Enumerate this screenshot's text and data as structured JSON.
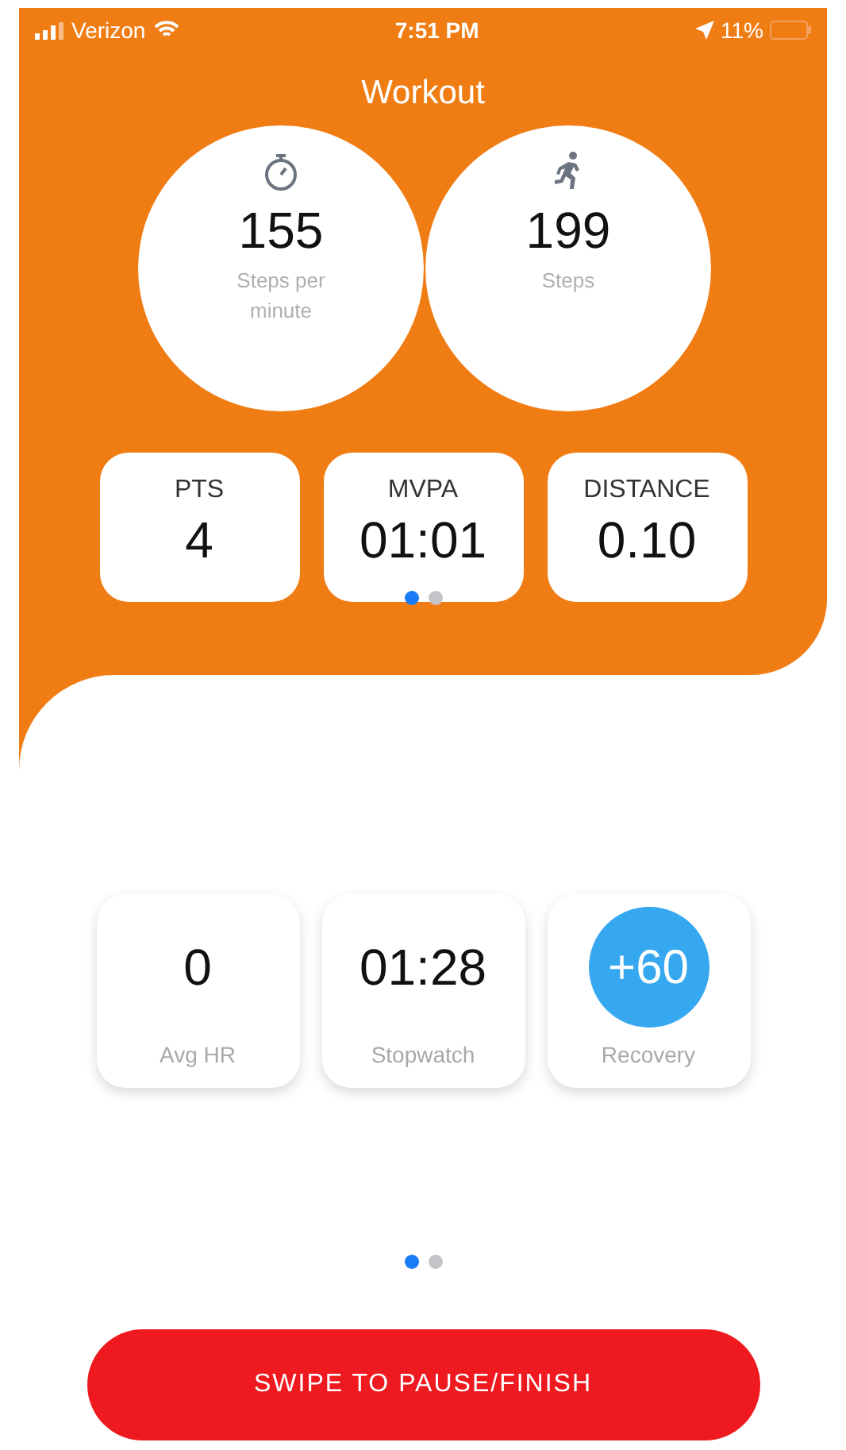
{
  "status_bar": {
    "carrier": "Verizon",
    "time": "7:51 PM",
    "battery": "11%"
  },
  "title": "Workout",
  "circles": [
    {
      "kind": "stopwatch",
      "value": "155",
      "label": "Steps per minute"
    },
    {
      "kind": "runner",
      "value": "199",
      "label": "Steps"
    }
  ],
  "top_cards": [
    {
      "label": "PTS",
      "value": "4"
    },
    {
      "label": "MVPA",
      "value": "01:01"
    },
    {
      "label": "DISTANCE",
      "value": "0.10"
    }
  ],
  "top_pager": [
    {
      "selected": true
    },
    {
      "selected": false
    }
  ],
  "bottom_cards": [
    {
      "kind": "plain",
      "value": "0",
      "label": "Avg HR"
    },
    {
      "kind": "plain",
      "value": "01:28",
      "label": "Stopwatch"
    },
    {
      "kind": "button",
      "value": "+60",
      "label": "Recovery"
    }
  ],
  "bottom_pager": [
    {
      "selected": true
    },
    {
      "selected": false
    }
  ],
  "swipe_button": "SWIPE TO PAUSE/FINISH"
}
